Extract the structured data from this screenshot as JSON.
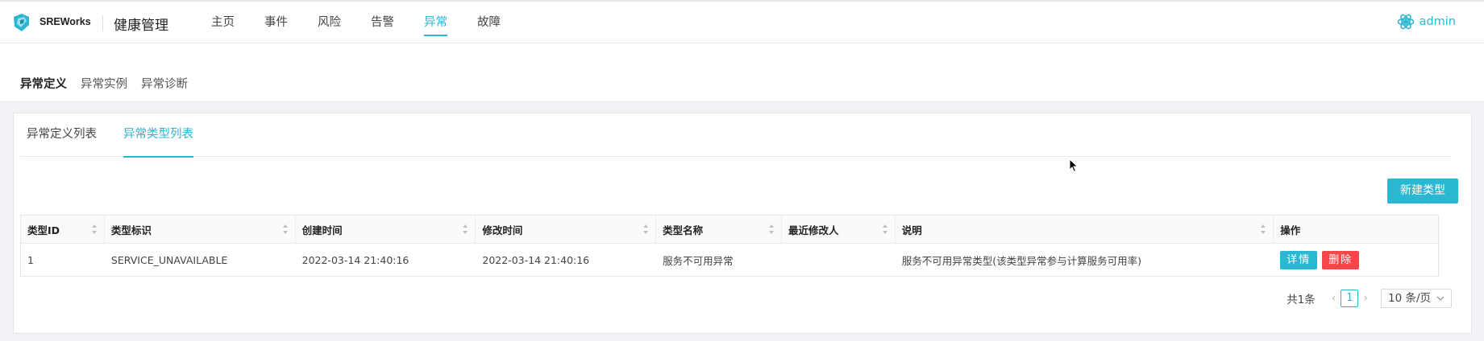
{
  "header": {
    "brand": "SREWorks",
    "app_title": "健康管理",
    "nav": [
      {
        "label": "主页",
        "active": false
      },
      {
        "label": "事件",
        "active": false
      },
      {
        "label": "风险",
        "active": false
      },
      {
        "label": "告警",
        "active": false
      },
      {
        "label": "异常",
        "active": true
      },
      {
        "label": "故障",
        "active": false
      }
    ],
    "user": "admin"
  },
  "subnav": [
    {
      "label": "异常定义",
      "active": true
    },
    {
      "label": "异常实例",
      "active": false
    },
    {
      "label": "异常诊断",
      "active": false
    }
  ],
  "tabs": [
    {
      "label": "异常定义列表",
      "active": false
    },
    {
      "label": "异常类型列表",
      "active": true
    }
  ],
  "toolbar": {
    "new_label": "新建类型"
  },
  "table": {
    "columns": [
      "类型ID",
      "类型标识",
      "创建时间",
      "修改时间",
      "类型名称",
      "最近修改人",
      "说明",
      "操作"
    ],
    "rows": [
      [
        "1",
        "SERVICE_UNAVAILABLE",
        "2022-03-14 21:40:16",
        "2022-03-14 21:40:16",
        "服务不可用异常",
        "",
        "服务不可用异常类型(该类型异常参与计算服务可用率)"
      ]
    ],
    "actions": {
      "detail": "详情",
      "delete": "删除"
    }
  },
  "pagination": {
    "total": "共1条",
    "current_page": "1",
    "page_size": "10 条/页"
  },
  "colors": {
    "accent": "#2ab7d2",
    "danger": "#f5474a"
  }
}
